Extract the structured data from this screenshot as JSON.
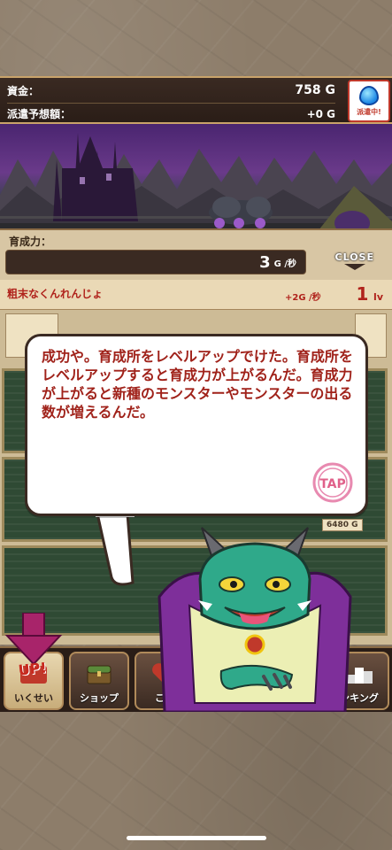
{
  "top": {
    "funds_label": "資金：",
    "funds_value": "758 G",
    "dispatch_label": "派遣予想額：",
    "dispatch_value": "+0 G",
    "dispatch_button_label": "派遣中!",
    "dispatch_icon": "water-drop-icon"
  },
  "growth": {
    "label": "育成力：",
    "value": "3",
    "unit": "G /秒",
    "close_label": "CLOSE"
  },
  "facility": {
    "name": "粗末なくんれんじょ",
    "rate": "+2G /秒",
    "level_number": "1",
    "level_unit": "lv",
    "prices": [
      "6480 G"
    ]
  },
  "dialogue": {
    "text": "成功や。育成所をレベルアップでけた。育成所をレベルアップすると育成力が上がるんだ。育成力が上がると新種のモンスターやモンスターの出る数が増えるんだ。",
    "tap_label": "TAP"
  },
  "nav": {
    "items": [
      {
        "label": "いくせい",
        "icon": "upgrade-icon"
      },
      {
        "label": "ショップ",
        "icon": "shop-chest-icon"
      },
      {
        "label": "こう",
        "icon": "heart-icon"
      },
      {
        "label": "ンキング",
        "icon": "podium-icon"
      }
    ],
    "up_badge": "UP!"
  },
  "colors": {
    "accent_red": "#b0231c",
    "panel_dark": "#2a1d17",
    "gold_border": "#c9a36a",
    "dragon_green": "#2fa98a",
    "cape_purple": "#8a3aa8"
  }
}
